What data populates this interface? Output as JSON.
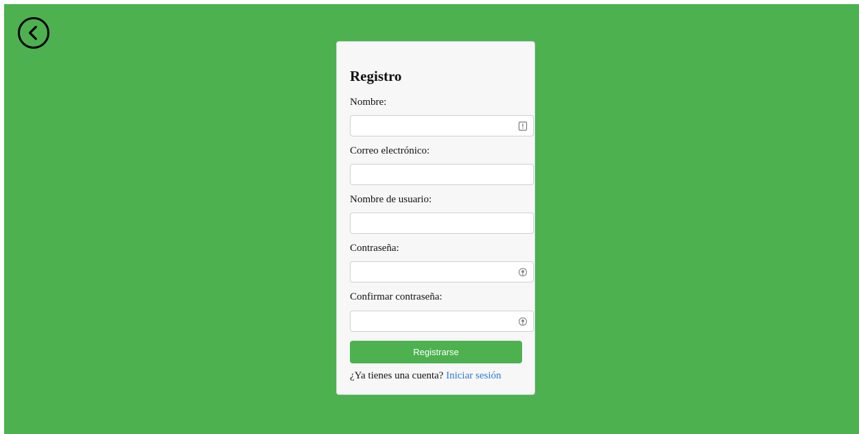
{
  "back_button": {
    "icon": "chevron-left-icon"
  },
  "form": {
    "title": "Registro",
    "fields": [
      {
        "label": "Nombre:",
        "value": "",
        "icon": "contact-card-icon"
      },
      {
        "label": "Correo electrónico:",
        "value": ""
      },
      {
        "label": "Nombre de usuario:",
        "value": ""
      },
      {
        "label": "Contraseña:",
        "value": "",
        "icon": "password-key-icon"
      },
      {
        "label": "Confirmar contraseña:",
        "value": "",
        "icon": "password-key-icon"
      }
    ],
    "submit_label": "Registrarse",
    "login_prompt": "¿Ya tienes una cuenta?",
    "login_link": "Iniciar sesión"
  },
  "colors": {
    "background": "#4db150",
    "button": "#4db150",
    "link": "#2a7ad8"
  }
}
